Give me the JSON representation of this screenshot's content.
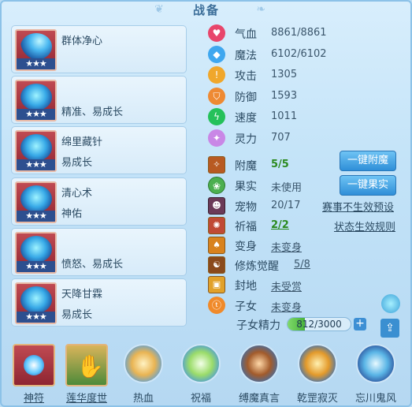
{
  "window": {
    "title": "战备"
  },
  "cards": [
    {
      "name": "群体净心",
      "desc": "",
      "stars": "★★★"
    },
    {
      "name": "",
      "desc": "精准、易成长",
      "stars": "★★★"
    },
    {
      "name": "绵里藏针",
      "desc": "易成长",
      "stars": "★★★"
    },
    {
      "name": "清心术",
      "desc": "神佑",
      "stars": "★★★"
    },
    {
      "name": "",
      "desc": "愤怒、易成长",
      "stars": "★★★"
    },
    {
      "name": "天降甘霖",
      "desc": "易成长",
      "stars": "★★★"
    }
  ],
  "stats": [
    {
      "label": "气血",
      "value": "8861/8861",
      "color": "#e8466b"
    },
    {
      "label": "魔法",
      "value": "6102/6102",
      "color": "#3fa7ef"
    },
    {
      "label": "攻击",
      "value": "1305",
      "color": "#f0a72b"
    },
    {
      "label": "防御",
      "value": "1593",
      "color": "#ee8a33"
    },
    {
      "label": "速度",
      "value": "1011",
      "color": "#25c15a"
    },
    {
      "label": "灵力",
      "value": "707",
      "color": "#c987e6"
    }
  ],
  "extras": {
    "fumo": {
      "label": "附魔",
      "value": "5/5"
    },
    "guoshi": {
      "label": "果实",
      "value": "未使用"
    },
    "chongwu": {
      "label": "宠物",
      "value": "20/17"
    },
    "qifu": {
      "label": "祈福",
      "value": "2/2"
    },
    "bianshen": {
      "label": "变身",
      "value": "未变身"
    },
    "xiulian": {
      "label": "修炼觉醒",
      "value": "5/8"
    },
    "fengdi": {
      "label": "封地",
      "value": "未受赏"
    },
    "zinv": {
      "label": "子女",
      "value": "未变身"
    },
    "zinv_energy": {
      "label": "子女精力",
      "value": "812/3000",
      "current": 812,
      "max": 3000
    }
  },
  "buttons": {
    "fumo": "一键附魔",
    "guoshi": "一键果实"
  },
  "links": {
    "preset": "赛事不生效预设",
    "rules": "状态生效规则"
  },
  "skills": [
    {
      "label": "神符"
    },
    {
      "label": "莲华度世"
    },
    {
      "label": "热血"
    },
    {
      "label": "祝福"
    },
    {
      "label": "缚魔真言"
    },
    {
      "label": "乾罡寂灭"
    },
    {
      "label": "忘川鬼风"
    }
  ],
  "colors": {
    "accent": "#2f8fd8",
    "green": "#2b8a1e"
  }
}
